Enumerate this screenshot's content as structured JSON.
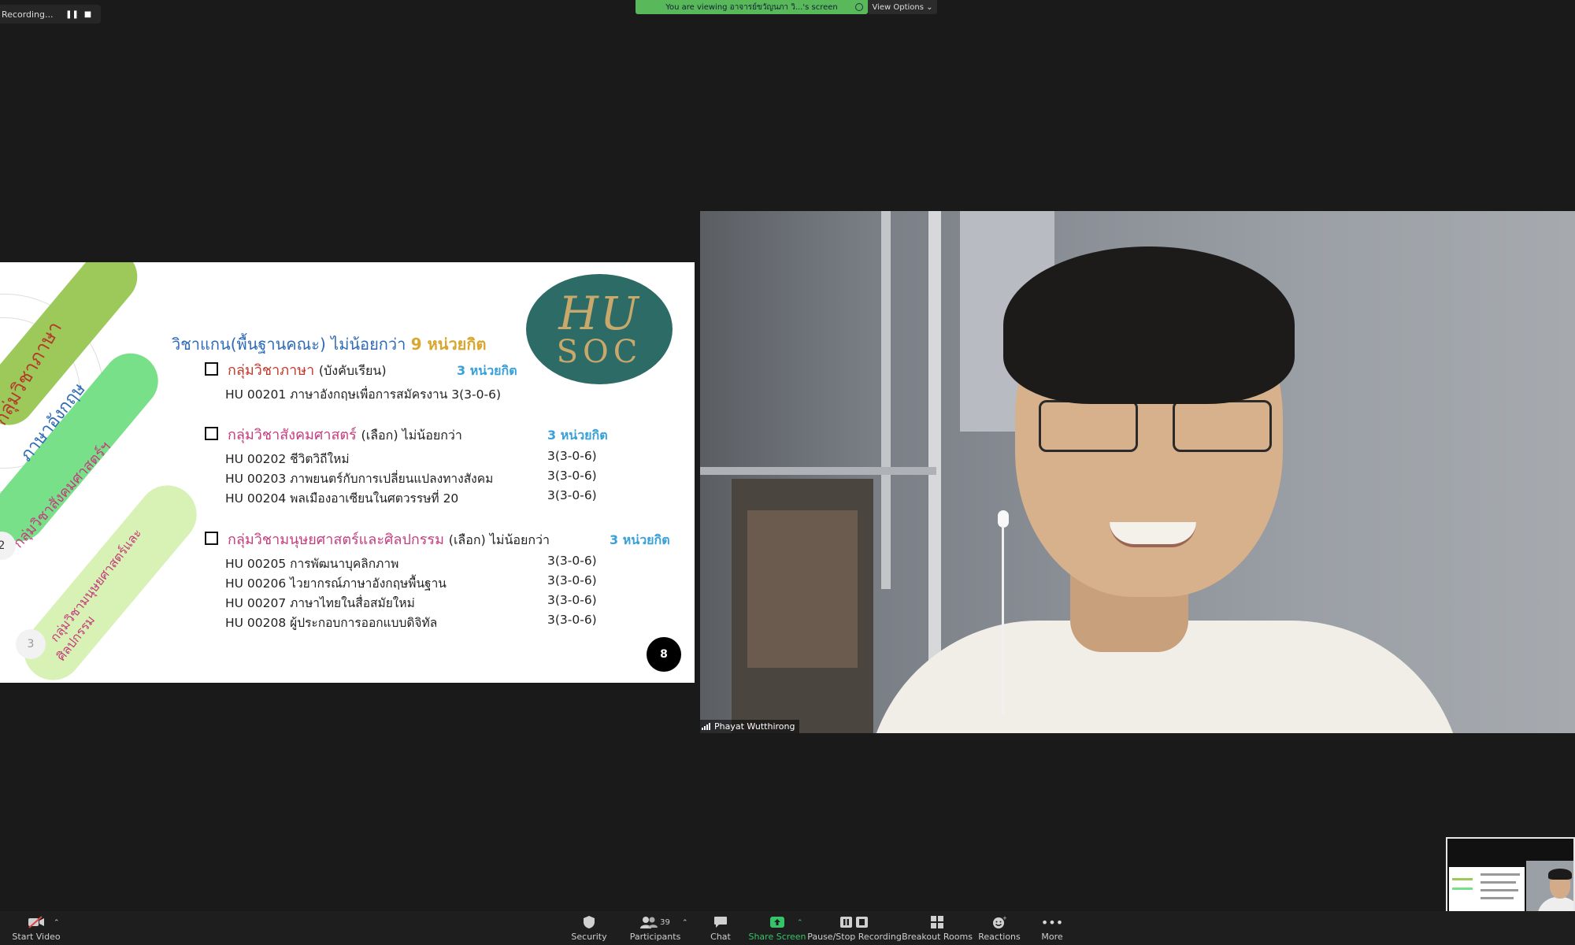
{
  "recording": {
    "label": "Recording...",
    "pause_icon": "pause-icon",
    "stop_icon": "stop-icon"
  },
  "banner": {
    "viewing_text": "You are viewing อาจารย์ขวัญนภา วิ...'s screen",
    "view_options": "View Options"
  },
  "slide": {
    "title_text": "วิชาแกน(พื้นฐานคณะ) ไม่น้อยกว่า",
    "title_credit": "9 หน่วยกิต",
    "logo": {
      "line1": "HU",
      "line2": "SOC"
    },
    "page_number": "8",
    "pills": {
      "p1": "กลุ่มวิชาภาษา",
      "p1b": "ภาษาอังกฤษ",
      "p2": "กลุ่มวิชาสังคมศาสตร์ฯ",
      "p3a": "กลุ่มวิชามนุษยศาสตร์และ",
      "p3b": "ศิลปกรรม",
      "circle2": "2",
      "circle3": "3"
    },
    "groups": [
      {
        "name": "กลุ่มวิชาภาษา",
        "note": "(บังคับเรียน)",
        "min_text": "",
        "credit": "3 หน่วยกิต",
        "courses": [
          {
            "line": "HU 00201 ภาษาอังกฤษเพื่อการสมัครงาน 3(3-0-6)"
          }
        ]
      },
      {
        "name": "กลุ่มวิชาสังคมศาสตร์",
        "note": "(เลือก) ไม่น้อยกว่า",
        "credit": "3 หน่วยกิต",
        "courses": [
          {
            "line": "HU 00202 ชีวิตวิถีใหม่",
            "credits": "3(3-0-6)"
          },
          {
            "line": "HU 00203 ภาพยนตร์กับการเปลี่ยนแปลงทางสังคม",
            "credits": "3(3-0-6)"
          },
          {
            "line": "HU 00204 พลเมืองอาเซียนในศตวรรษที่ 20",
            "credits": "3(3-0-6)"
          }
        ]
      },
      {
        "name": "กลุ่มวิชามนุษยศาสตร์และศิลปกรรม",
        "note": "(เลือก) ไม่น้อยกว่า",
        "credit": "3 หน่วยกิต",
        "courses": [
          {
            "line": "HU 00205 การพัฒนาบุคลิกภาพ",
            "credits": "3(3-0-6)"
          },
          {
            "line": "HU 00206 ไวยากรณ์ภาษาอังกฤษพื้นฐาน",
            "credits": "3(3-0-6)"
          },
          {
            "line": "HU 00207 ภาษาไทยในสื่อสมัยใหม่",
            "credits": "3(3-0-6)"
          },
          {
            "line": "HU 00208 ผู้ประกอบการออกแบบดิจิทัล",
            "credits": "3(3-0-6)"
          }
        ]
      }
    ]
  },
  "video": {
    "participant_name": "Phayat Wutthirong"
  },
  "toolbar": {
    "start_video": "Start Video",
    "security": "Security",
    "participants": "Participants",
    "participants_count": "39",
    "chat": "Chat",
    "share_screen": "Share Screen",
    "pause_stop": "Pause/Stop Recording",
    "breakout": "Breakout Rooms",
    "reactions": "Reactions",
    "more": "More"
  },
  "colors": {
    "share_green": "#35c46a",
    "banner_green": "#59b859",
    "logo_teal": "#2d6b66"
  }
}
